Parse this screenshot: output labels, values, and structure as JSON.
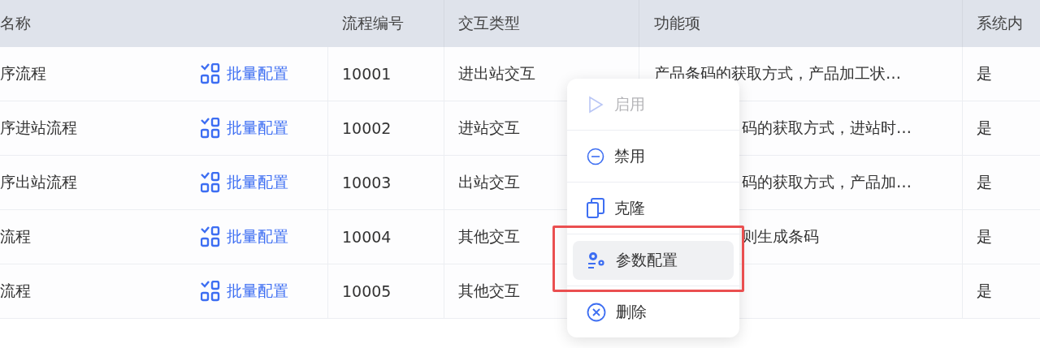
{
  "table": {
    "columns": [
      "名称",
      "流程编号",
      "交互类型",
      "功能项",
      "系统内"
    ],
    "rows": [
      {
        "name": "序流程",
        "action": "批量配置",
        "number": "10001",
        "type": "进出站交互",
        "functions": "产品条码的获取方式，产品加工状…",
        "functions_covered": false,
        "system": "是"
      },
      {
        "name": "序进站流程",
        "action": "批量配置",
        "number": "10002",
        "type": "进站交互",
        "functions": "码的获取方式，进站时…",
        "functions_covered": true,
        "system": "是"
      },
      {
        "name": "序出站流程",
        "action": "批量配置",
        "number": "10003",
        "type": "出站交互",
        "functions": "码的获取方式，产品加…",
        "functions_covered": true,
        "system": "是"
      },
      {
        "name": "流程",
        "action": "批量配置",
        "number": "10004",
        "type": "其他交互",
        "functions": "则生成条码",
        "functions_covered": true,
        "system": "是"
      },
      {
        "name": "流程",
        "action": "批量配置",
        "number": "10005",
        "type": "其他交互",
        "system": "是"
      }
    ]
  },
  "context_menu": {
    "items": [
      {
        "kind": "enable",
        "label": "启用",
        "disabled": true,
        "selected": false
      },
      {
        "kind": "disable",
        "label": "禁用",
        "disabled": false,
        "selected": false
      },
      {
        "kind": "clone",
        "label": "克隆",
        "disabled": false,
        "selected": false
      },
      {
        "kind": "params",
        "label": "参数配置",
        "disabled": false,
        "selected": true
      },
      {
        "kind": "delete",
        "label": "删除",
        "disabled": false,
        "selected": false
      }
    ]
  }
}
